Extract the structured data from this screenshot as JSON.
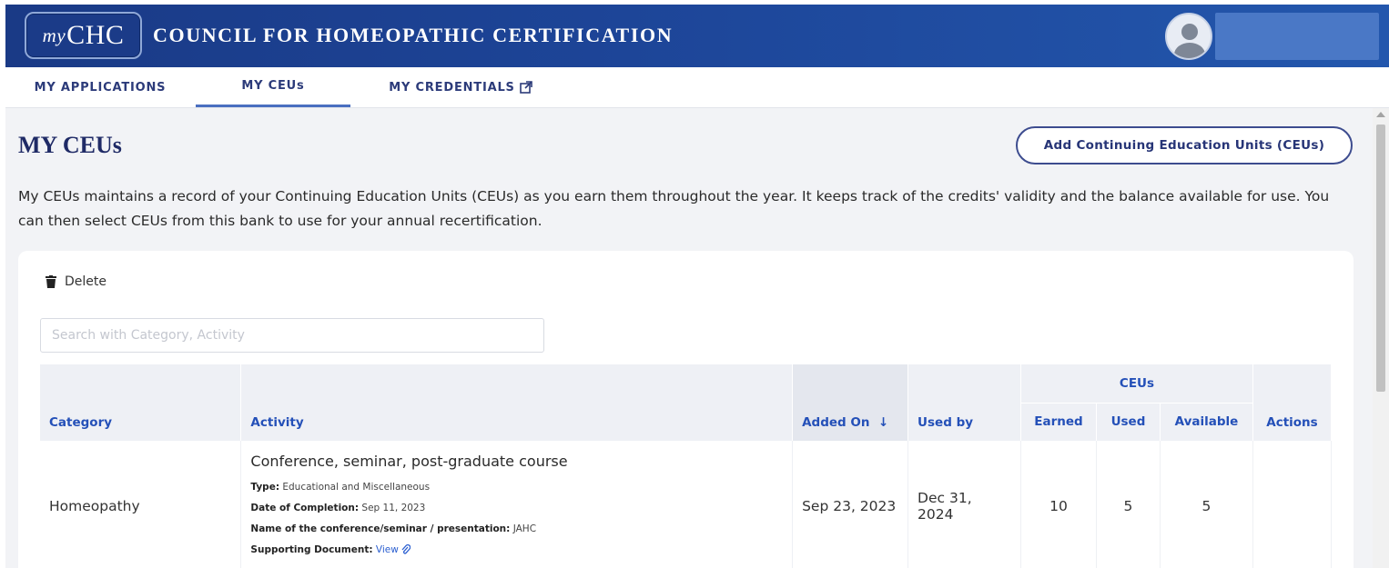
{
  "header": {
    "logo_my": "my",
    "logo_chc": "CHC",
    "org_title": "COUNCIL FOR HOMEOPATHIC CERTIFICATION"
  },
  "tabs": [
    {
      "label": "MY APPLICATIONS",
      "active": false
    },
    {
      "label": "MY CEUs",
      "active": true
    },
    {
      "label": "MY CREDENTIALS",
      "active": false,
      "icon": "external-link-icon"
    }
  ],
  "main": {
    "title": "MY CEUs",
    "add_button": "Add Continuing Education Units (CEUs)",
    "description": "My CEUs maintains a record of your Continuing Education Units (CEUs) as you earn them throughout the year. It keeps track of the credits' validity and the balance available for use. You can then select CEUs from this bank to use for your annual recertification."
  },
  "toolbar": {
    "delete_label": "Delete",
    "search_placeholder": "Search with Category, Activity"
  },
  "table": {
    "group_header": "CEUs",
    "columns": {
      "category": "Category",
      "activity": "Activity",
      "added_on": "Added On",
      "sort_indicator": "↓",
      "used_by": "Used by",
      "earned": "Earned",
      "used": "Used",
      "available": "Available",
      "actions": "Actions"
    },
    "rows": [
      {
        "category": "Homeopathy",
        "activity_title": "Conference, seminar, post-graduate course",
        "type_label": "Type:",
        "type_value": "Educational and Miscellaneous",
        "date_label": "Date of Completion:",
        "date_value": "Sep 11, 2023",
        "name_label": "Name of the conference/seminar / presentation:",
        "name_value": "JAHC",
        "doc_label": "Supporting Document:",
        "doc_link": "View",
        "added_on": "Sep 23, 2023",
        "used_by": "Dec 31, 2024",
        "earned": "10",
        "used": "5",
        "available": "5"
      }
    ]
  },
  "colors": {
    "header_bg": "#1d4598",
    "accent_blue": "#2450b8",
    "title_navy": "#1f2a66"
  }
}
